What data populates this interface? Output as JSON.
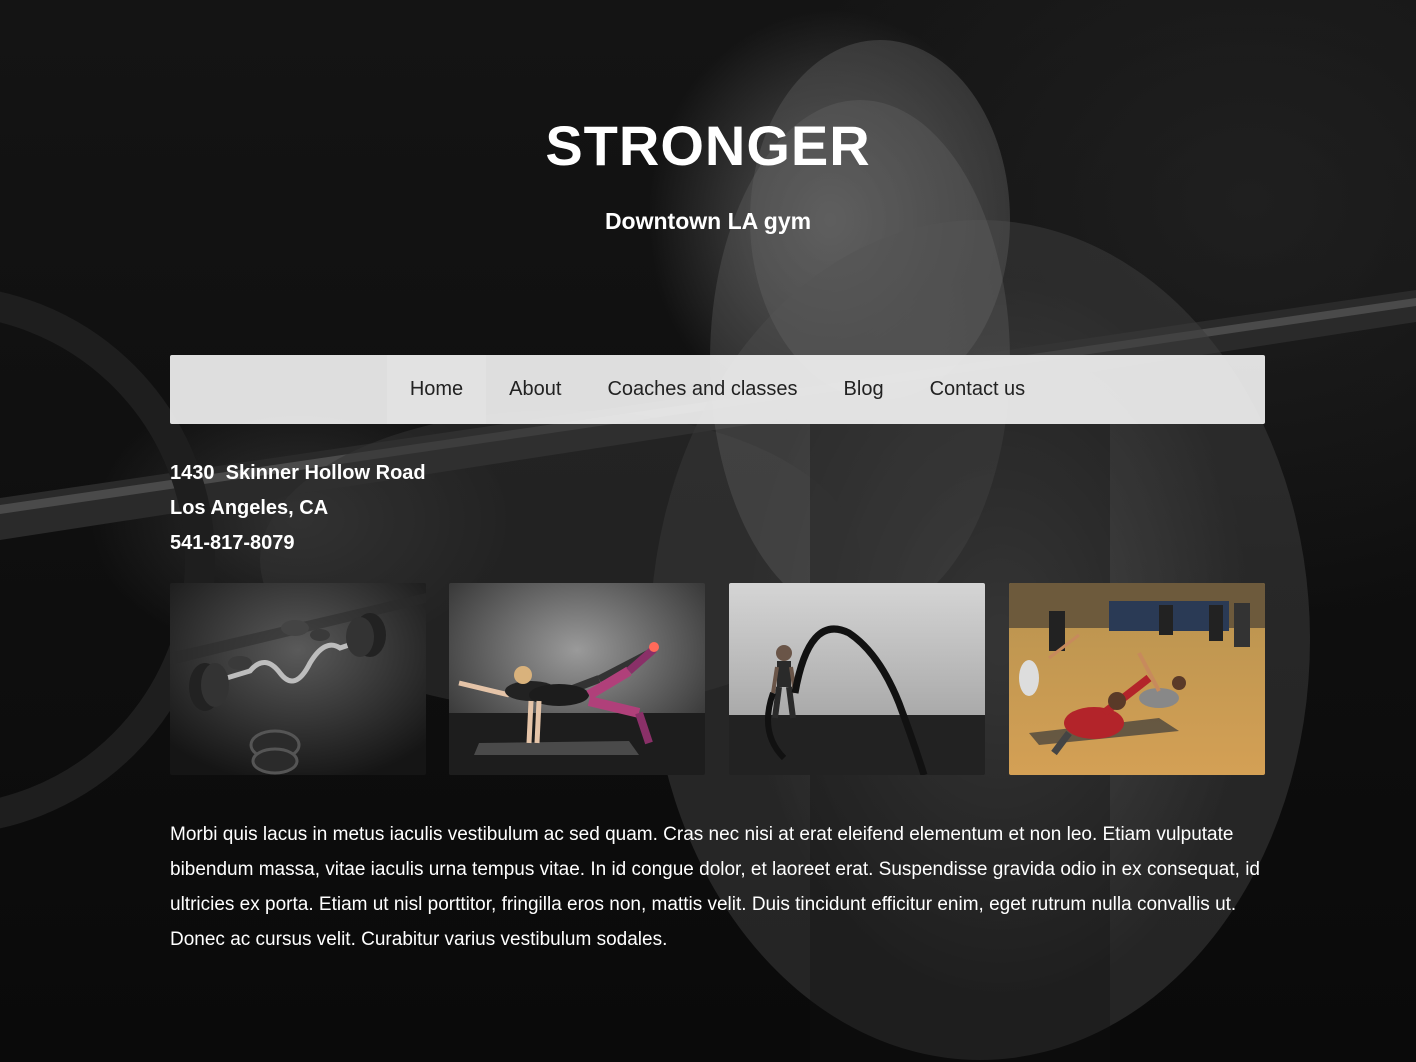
{
  "header": {
    "title": "STRONGER",
    "subtitle": "Downtown LA gym"
  },
  "nav": {
    "items": [
      {
        "label": "Home",
        "active": true
      },
      {
        "label": "About",
        "active": false
      },
      {
        "label": "Coaches and classes",
        "active": false
      },
      {
        "label": "Blog",
        "active": false
      },
      {
        "label": "Contact us",
        "active": false
      }
    ]
  },
  "address": {
    "street": "1430  Skinner Hollow Road",
    "city": "Los Angeles, CA",
    "phone": "541-817-8079"
  },
  "gallery": {
    "photos": [
      {
        "subject": "dumbbell and weight plates"
      },
      {
        "subject": "women doing yoga balance pose"
      },
      {
        "subject": "athlete with battle ropes"
      },
      {
        "subject": "group stretching class"
      }
    ]
  },
  "content": {
    "paragraph": "Morbi quis lacus in metus iaculis vestibulum ac sed quam. Cras nec nisi at erat eleifend elementum et non leo. Etiam vulputate bibendum massa, vitae iaculis urna tempus vitae. In id congue dolor, et laoreet erat. Suspendisse gravida odio in ex consequat, id ultricies ex porta. Etiam ut nisl porttitor, fringilla eros non, mattis velit. Duis tincidunt efficitur enim, eget rutrum nulla convallis ut. Donec ac cursus velit. Curabitur varius vestibulum sodales."
  },
  "colors": {
    "nav_background": "#f0f0f0",
    "nav_text": "#222222",
    "text": "#ffffff",
    "page_background": "#0b0b0b"
  }
}
